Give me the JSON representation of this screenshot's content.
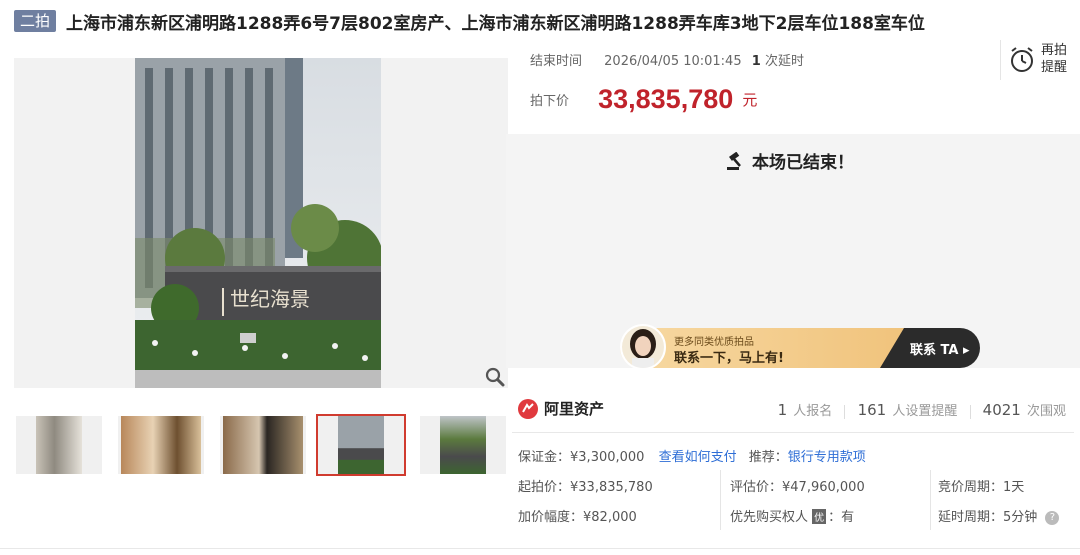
{
  "header": {
    "round_badge": "二拍",
    "title": "上海市浦东新区浦明路1288弄6号7层802室房产、上海市浦东新区浦明路1288弄车库3地下2层车位188室车位"
  },
  "auction": {
    "end_time_label": "结束时间",
    "end_time_value": "2026/04/05 10:01:45",
    "extension_count": "1",
    "extension_text": "次延时",
    "remind_label": "再拍提醒",
    "final_price_label": "拍下价",
    "final_price_value": "33,835,780",
    "final_price_unit": "元",
    "ended_message": "本场已结束！"
  },
  "contact_banner": {
    "line1": "更多同类优质拍品",
    "line2": "联系一下，马上有!",
    "cta": "联系 TA"
  },
  "stats": {
    "brand": "阿里资产",
    "signups": "1",
    "signups_label": "人报名",
    "reminders": "161",
    "reminders_label": "人设置提醒",
    "views": "4021",
    "views_label": "次围观"
  },
  "details": {
    "deposit_label": "保证金：",
    "deposit_value": "¥3,300,000",
    "how_to_pay": "查看如何支付",
    "recommend_label": "推荐：",
    "recommend_value": "银行专用款项",
    "start_price_label": "起拍价：",
    "start_price_value": "¥33,835,780",
    "valuation_label": "评估价：",
    "valuation_value": "¥47,960,000",
    "cycle_label": "竞价周期：",
    "cycle_value": "1天",
    "increment_label": "加价幅度：",
    "increment_value": "¥82,000",
    "priority_label": "优先购买权人",
    "priority_badge": "优",
    "priority_value": "：有",
    "delay_label": "延时周期：",
    "delay_value": "5分钟"
  },
  "photo": {
    "sign_text": "世纪海景"
  },
  "colors": {
    "price_red": "#c0232b",
    "link_blue": "#2e6ed6",
    "badge_gray": "#6f7fa0",
    "active_thumb_border": "#d03b2f"
  }
}
